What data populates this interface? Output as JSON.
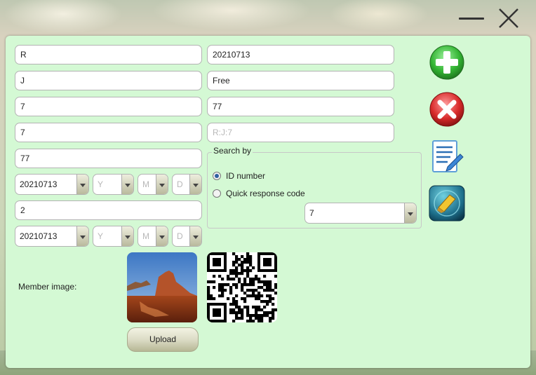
{
  "window": {
    "minimize_icon": "minimize-icon",
    "close_icon": "close-icon"
  },
  "left_fields": [
    "R",
    "J",
    "7",
    "7",
    "77"
  ],
  "date_row1": {
    "date": "20210713",
    "year": "Y",
    "month": "M",
    "day": "D"
  },
  "field_after_date": "2",
  "date_row2": {
    "date": "20210713",
    "year": "Y",
    "month": "M",
    "day": "D"
  },
  "right_fields": {
    "f1": "20210713",
    "f2": "Free",
    "f3": "77",
    "f4": "R:J:7"
  },
  "search": {
    "legend": "Search by",
    "option_id": "ID number",
    "option_qr": "Quick response code",
    "selected": "ID number",
    "combo_value": "7"
  },
  "member_image_label": "Member image:",
  "upload_label": "Upload",
  "actions": [
    "add-icon",
    "delete-icon",
    "edit-icon",
    "clear-icon"
  ],
  "colors": {
    "panel_bg": "#d4f9d4",
    "add_green": "#33b433",
    "delete_red": "#d82a2a"
  }
}
